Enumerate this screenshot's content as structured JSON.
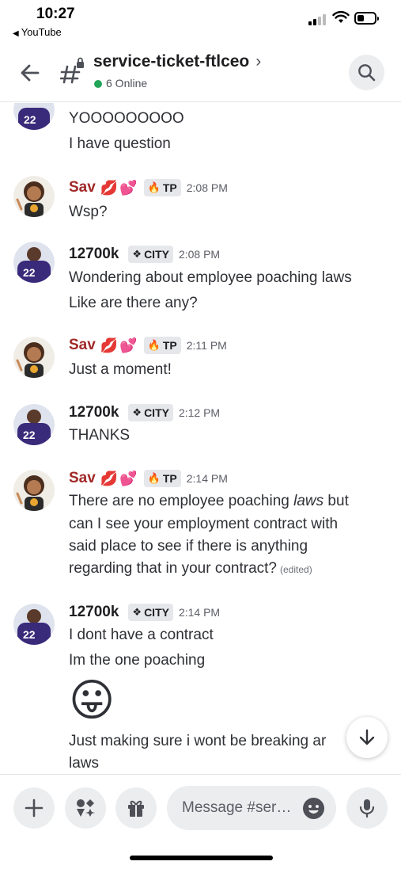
{
  "status_bar": {
    "time": "10:27",
    "back_app": "YouTube"
  },
  "header": {
    "channel_name": "service-ticket-ftlceo",
    "chevron": "›",
    "online_text": "6 Online",
    "online_color": "#23a55a"
  },
  "messages": [
    {
      "type": "continuation",
      "lines": [
        "YOOOOOOOOO",
        "I have question"
      ]
    },
    {
      "author": "Sav",
      "author_emojis": [
        "💋",
        "💕"
      ],
      "tag_icon": "🔥",
      "tag": "TP",
      "time": "2:08 PM",
      "lines": [
        "Wsp?"
      ]
    },
    {
      "author": "12700k",
      "tag_icon": "❖",
      "tag": "CITY",
      "time": "2:08 PM",
      "lines": [
        "Wondering about employee poaching laws",
        "Like are there any?"
      ]
    },
    {
      "author": "Sav",
      "author_emojis": [
        "💋",
        "💕"
      ],
      "tag_icon": "🔥",
      "tag": "TP",
      "time": "2:11 PM",
      "lines": [
        "Just a moment!"
      ]
    },
    {
      "author": "12700k",
      "tag_icon": "❖",
      "tag": "CITY",
      "time": "2:12 PM",
      "lines": [
        "THANKS"
      ]
    },
    {
      "author": "Sav",
      "author_emojis": [
        "💋",
        "💕"
      ],
      "tag_icon": "🔥",
      "tag": "TP",
      "time": "2:14 PM",
      "lines": [
        "There are no employee poaching ",
        "laws",
        " but",
        "can I see your employment contract with",
        "said place to see if there is anything",
        "regarding that in your contract?"
      ],
      "edited": "(edited)"
    },
    {
      "author": "12700k",
      "tag_icon": "❖",
      "tag": "CITY",
      "time": "2:14 PM",
      "lines": [
        "I dont have a contract",
        "Im the one poaching",
        "😛",
        "Just making sure i wont be breaking ar",
        "laws"
      ]
    }
  ],
  "input": {
    "placeholder": "Message #ser…"
  },
  "colors": {
    "sav_name": "#a12828",
    "city_name": "#1f1f22",
    "online_dot": "#23a55a"
  },
  "icons": [
    "back-arrow-icon",
    "hash-lock-icon",
    "search-icon",
    "plus-icon",
    "apps-icon",
    "gift-icon",
    "emoji-icon",
    "microphone-icon",
    "arrow-down-icon"
  ]
}
